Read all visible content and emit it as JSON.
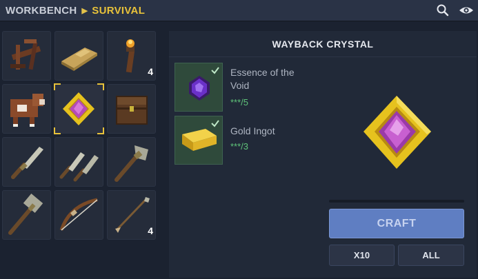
{
  "breadcrumb": {
    "root": "WORKBENCH",
    "current": "SURVIVAL"
  },
  "toolbar": {
    "search_icon": "search-icon",
    "visibility_icon": "eye-icon"
  },
  "grid": {
    "slots": [
      {
        "item": "wooden-crossbow-stand",
        "count": ""
      },
      {
        "item": "straw-bedroll",
        "count": ""
      },
      {
        "item": "torch",
        "count": "4"
      },
      {
        "item": "brown-cow",
        "count": ""
      },
      {
        "item": "wayback-crystal",
        "count": "",
        "selected": true
      },
      {
        "item": "wooden-chest",
        "count": ""
      },
      {
        "item": "stone-knife",
        "count": ""
      },
      {
        "item": "stone-daggers",
        "count": ""
      },
      {
        "item": "stone-axe",
        "count": ""
      },
      {
        "item": "stone-hammer",
        "count": ""
      },
      {
        "item": "wooden-bow",
        "count": ""
      },
      {
        "item": "stone-arrows",
        "count": "4"
      }
    ]
  },
  "recipe": {
    "title": "WAYBACK CRYSTAL",
    "ingredients": [
      {
        "name": "Essence of the Void",
        "amount": "***/5"
      },
      {
        "name": "Gold Ingot",
        "amount": "***/3"
      }
    ],
    "craft_label": "CRAFT",
    "x10_label": "X10",
    "all_label": "ALL"
  },
  "colors": {
    "accent": "#e8c23a",
    "craft_button": "#5f7ec2",
    "ingredient_ok": "#2f4a3b",
    "amount_text": "#5fc47a"
  }
}
